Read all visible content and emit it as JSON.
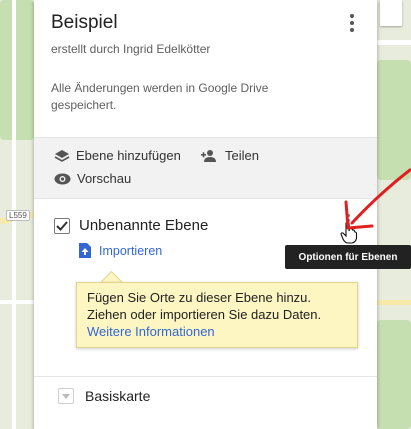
{
  "map_title": "Beispiel",
  "author": "erstellt durch Ingrid Edelkötter",
  "save_status": "Alle Änderungen werden in Google Drive gespeichert.",
  "toolbar": {
    "add_layer": "Ebene hinzufügen",
    "share": "Teilen",
    "preview": "Vorschau"
  },
  "layer": {
    "name": "Unbenannte Ebene",
    "checked": true,
    "import_label": "Importieren"
  },
  "hint": {
    "text": "Fügen Sie Orte zu dieser Ebene hinzu. Ziehen oder importieren Sie dazu Daten.",
    "link": "Weitere Informationen"
  },
  "basemap": {
    "label": "Basiskarte"
  },
  "tooltip": "Optionen für Ebenen",
  "map_label": "L559",
  "colors": {
    "link": "#3367d6",
    "hint_bg": "#fdf6c2",
    "annotation_arrow": "#e02020"
  }
}
